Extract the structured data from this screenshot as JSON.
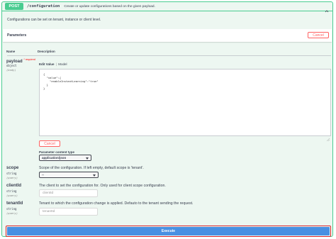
{
  "operation": {
    "method": "POST",
    "path": "/configuration",
    "summary": "Create or update configurations based on the given payload.",
    "description": "Configurations can be set on tenant, instance or client level."
  },
  "parameters": {
    "title": "Parameters",
    "cancel_label": "Cancel",
    "col_name": "Name",
    "col_description": "Description"
  },
  "payload": {
    "name": "payload",
    "required_label": "* required",
    "type": "object",
    "location": "(body)",
    "tab_edit": "Edit Value",
    "tab_model": "Model",
    "tab_separator": "|",
    "body_text": "{\n  \"value\":{\n    \"enableInstantLearning\":\"true\"\n  }\n}",
    "cancel_label": "Cancel",
    "content_type_label": "Parameter content type",
    "content_type_value": "application/json"
  },
  "scope": {
    "name": "scope",
    "type": "string",
    "location": "(query)",
    "description": "Scope of the configuration. If left empty, default scope is 'tenant'.",
    "select_value": "--"
  },
  "clientId": {
    "name": "clientId",
    "type": "string",
    "location": "(query)",
    "description": "The client to set the configuration for. Only used for client scope configuration.",
    "placeholder": "clientId"
  },
  "tenantId": {
    "name": "tenantId",
    "type": "string",
    "location": "(query)",
    "description": "Tenant to which the configuration change is applied. Defauto to the tenant sending the request.",
    "placeholder": "tenantId"
  },
  "execute_label": "Execute",
  "colors": {
    "post_green": "#49cc90",
    "post_bg": "#edf7f1",
    "cancel_red": "#ff6060",
    "execute_blue": "#4990e2",
    "focus_red": "#d9252b"
  },
  "icons": {
    "collapse": "chevron-up-icon",
    "select": "chevron-down-icon"
  }
}
